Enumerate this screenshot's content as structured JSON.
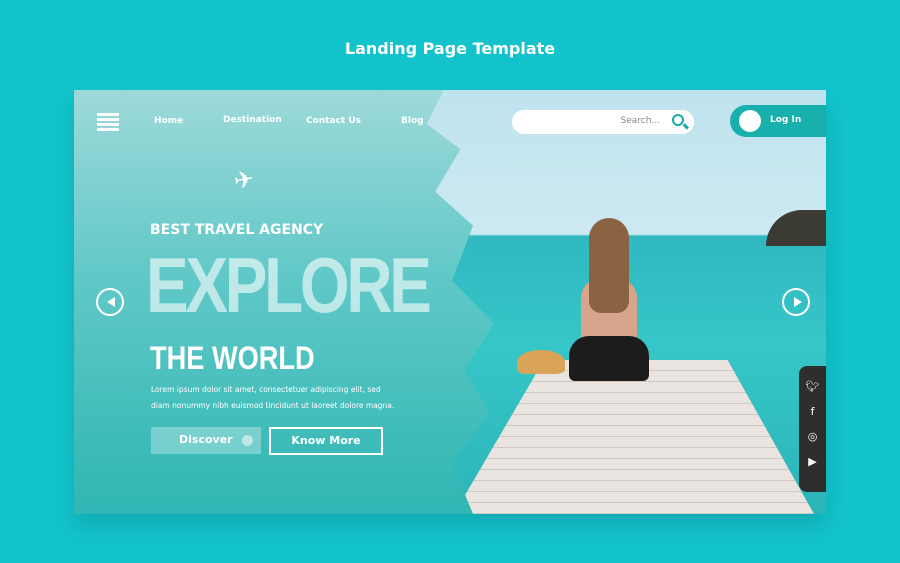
{
  "page_title": "Landing Page Template",
  "nav": {
    "items": [
      "Home",
      "Destination",
      "Contact Us",
      "Blog"
    ]
  },
  "search": {
    "placeholder": "Search..."
  },
  "login": {
    "label": "Log In"
  },
  "hero": {
    "subtitle": "BEST TRAVEL AGENCY",
    "headline": "EXPLORE",
    "headline2": "THE WORLD",
    "description": "Lorem ipsum dolor sit amet, consectetuer adipiscing elit, sed diam nonummy nibh euismod tincidunt ut laoreet dolore magna.",
    "discover_label": "Discover",
    "know_more_label": "Know More"
  },
  "social": [
    "twitter-icon",
    "facebook-icon",
    "instagram-icon",
    "youtube-icon"
  ],
  "colors": {
    "background": "#12c3cb",
    "accent": "#18b0ad"
  }
}
